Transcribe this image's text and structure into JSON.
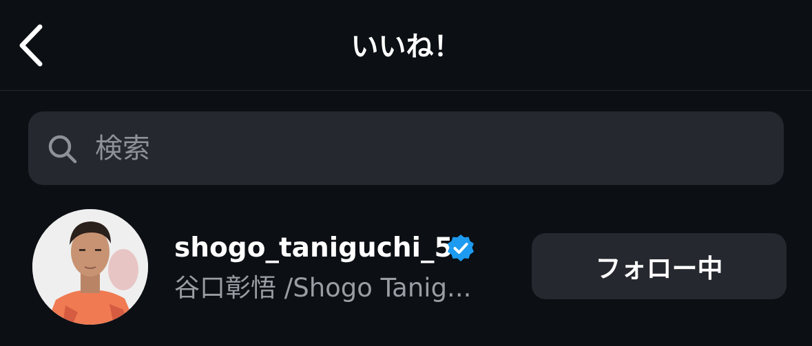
{
  "header": {
    "back_icon": "chevron-left-icon",
    "title": "いいね！"
  },
  "search": {
    "icon": "search-icon",
    "placeholder": "検索",
    "value": ""
  },
  "likes": [
    {
      "username": "shogo_taniguchi_5",
      "verified": true,
      "full_name": "谷口彰悟 /Shogo Tanig...",
      "button_label": "フォロー中"
    }
  ],
  "colors": {
    "background": "#0c0f14",
    "surface": "#25282e",
    "verified_badge": "#1d9bf0",
    "secondary_text": "#9a9da3"
  }
}
